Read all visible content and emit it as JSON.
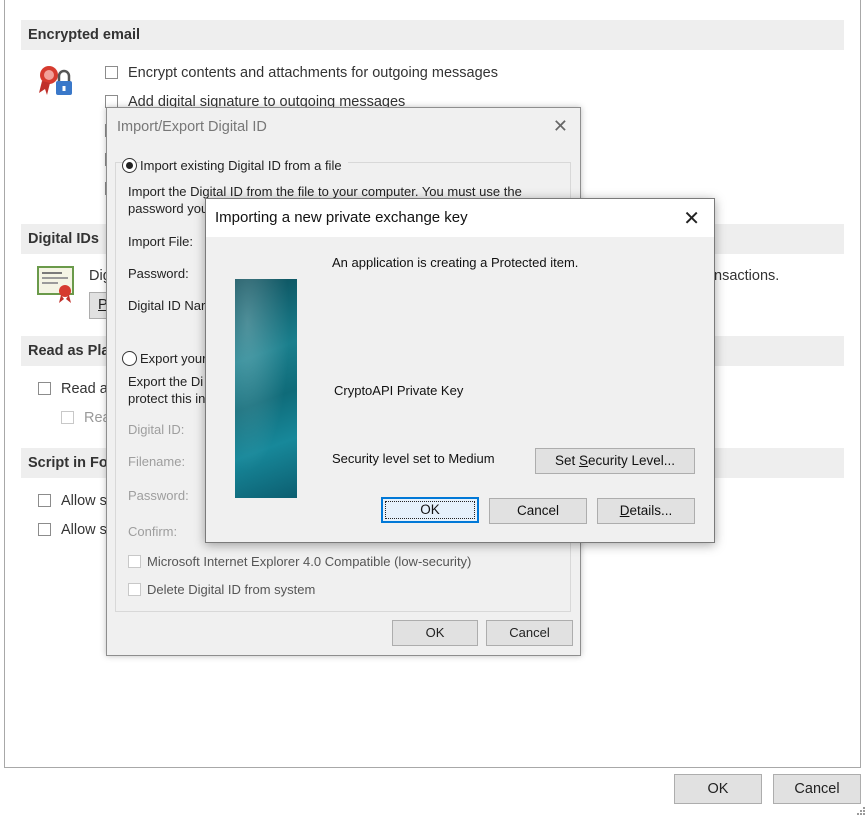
{
  "trust_center": {
    "encrypted_email": {
      "heading": "Encrypted email",
      "options": [
        {
          "label": "Encrypt contents and attachments for outgoing messages",
          "checked": false
        },
        {
          "label": "Add digital signature to outgoing messages",
          "checked": false
        }
      ]
    },
    "digital_ids": {
      "heading": "Digital IDs",
      "text_start": "Dig",
      "text_end": "nsactions.",
      "button_start": "P"
    },
    "read_as_plain": {
      "heading": "Read as Pla",
      "options": [
        {
          "label": "Read a",
          "checked": false
        },
        {
          "label": "Rea",
          "checked": false,
          "disabled": true
        }
      ]
    },
    "script_in_folders": {
      "heading": "Script in Fo",
      "options": [
        {
          "label": "Allow s",
          "checked": false
        },
        {
          "label": "Allow s",
          "checked": false
        }
      ]
    },
    "footer": {
      "ok_label": "OK",
      "cancel_label": "Cancel"
    }
  },
  "import_export_dialog": {
    "title": "Import/Export Digital ID",
    "import_option": {
      "label": "Import existing Digital ID from a file",
      "selected": true,
      "description_line1": "Import the Digital ID from the file to your computer. You must use the",
      "description_line2": "password you",
      "import_file_label": "Import File:",
      "password_label": "Password:",
      "digital_id_name_label": "Digital ID Nar"
    },
    "export_option": {
      "label": "Export your",
      "selected": false,
      "description_line1": "Export the Di",
      "description_line2": "protect this in",
      "digital_id_label": "Digital ID:",
      "filename_label": "Filename:",
      "password_label": "Password:",
      "confirm_label": "Confirm:",
      "ie4_compat_label": "Microsoft Internet Explorer 4.0 Compatible (low-security)",
      "delete_label": "Delete Digital ID from system"
    },
    "ok_label": "OK",
    "cancel_label": "Cancel"
  },
  "private_key_dialog": {
    "title": "Importing a new private exchange key",
    "message": "An application is creating a Protected item.",
    "item_name": "CryptoAPI Private Key",
    "security_level_text": "Security level set to Medium",
    "set_security_level_button": {
      "before": "Set ",
      "mnemonic": "S",
      "after": "ecurity Level..."
    },
    "ok_label": "OK",
    "cancel_label": "Cancel",
    "details_button": {
      "mnemonic": "D",
      "after": "etails..."
    }
  },
  "icons": [
    "certificate-lock-icon",
    "certificate-icon",
    "close-icon"
  ],
  "colors": {
    "default_button_border": "#0078d7",
    "section_header_bg": "#eeeeee"
  }
}
